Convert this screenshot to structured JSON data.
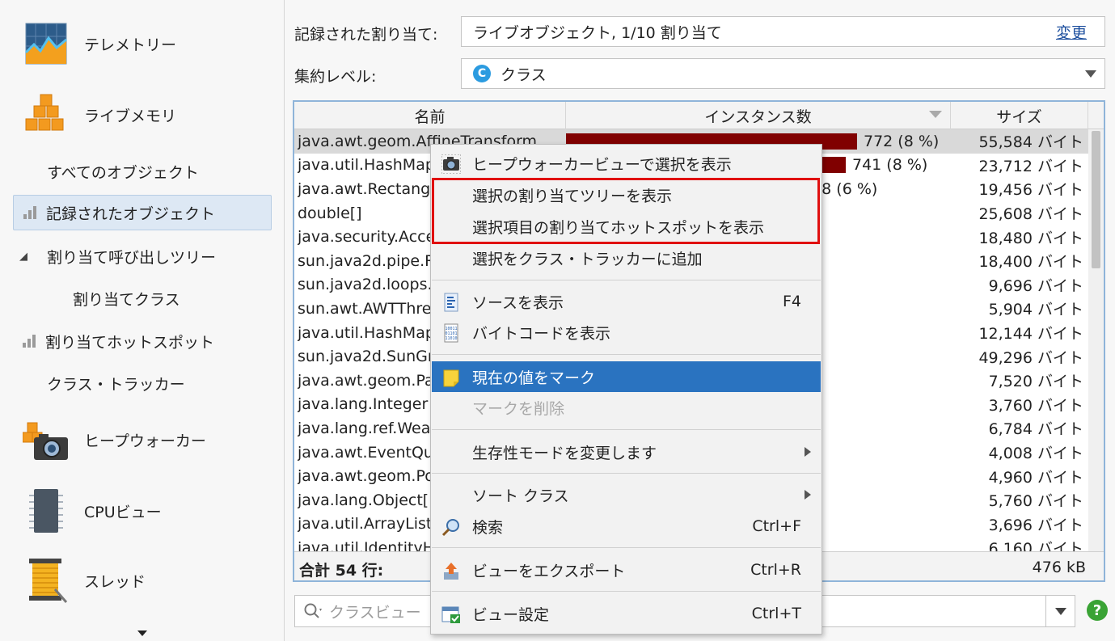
{
  "sidebar": {
    "items": [
      {
        "label": "テレメトリー",
        "icon": "telemetry-icon"
      },
      {
        "label": "ライブメモリ",
        "icon": "live-memory-icon"
      },
      {
        "label": "すべてのオブジェクト"
      },
      {
        "label": "記録されたオブジェクト",
        "selected": true
      },
      {
        "label": "割り当て呼び出しツリー"
      },
      {
        "label": "割り当てクラス"
      },
      {
        "label": "割り当てホットスポット"
      },
      {
        "label": "クラス・トラッカー"
      },
      {
        "label": "ヒープウォーカー",
        "icon": "heap-walker-icon"
      },
      {
        "label": "CPUビュー",
        "icon": "cpu-view-icon"
      },
      {
        "label": "スレッド",
        "icon": "threads-icon"
      }
    ]
  },
  "header": {
    "recorded_label": "記録された割り当て:",
    "recorded_value": "ライブオブジェクト, 1/10 割り当て",
    "change_link": "変更",
    "aggregation_label": "集約レベル:",
    "aggregation_icon_letter": "C",
    "aggregation_value": "クラス"
  },
  "table": {
    "columns": {
      "name": "名前",
      "instances": "インスタンス数",
      "size": "サイズ"
    },
    "rows": [
      {
        "name": "java.awt.geom.AffineTransform",
        "instances": "772 (8 %)",
        "size": "55,584 バイト",
        "bar": 1.0
      },
      {
        "name": "java.util.HashMap",
        "instances": "741 (8 %)",
        "size": "23,712 バイト",
        "bar": 0.96
      },
      {
        "name": "java.awt.Rectangle",
        "instances": "608 (6 %)",
        "size": "19,456 バイト",
        "bar": 0.79
      },
      {
        "name": "double[]",
        "instances": "",
        "size": "25,608 バイト",
        "bar": 0
      },
      {
        "name": "java.security.AccessControlContext",
        "instances": "",
        "size": "18,480 バイト",
        "bar": 0
      },
      {
        "name": "sun.java2d.pipe.Region",
        "instances": "",
        "size": "18,400 バイト",
        "bar": 0
      },
      {
        "name": "sun.java2d.loops.FontInfo",
        "instances": "",
        "size": "9,696 バイト",
        "bar": 0
      },
      {
        "name": "sun.awt.AWTThreading",
        "instances": "",
        "size": "5,904 バイト",
        "bar": 0
      },
      {
        "name": "java.util.HashMap$Node",
        "instances": "",
        "size": "12,144 バイト",
        "bar": 0
      },
      {
        "name": "sun.java2d.SunGraphics2D",
        "instances": "",
        "size": "49,296 バイト",
        "bar": 0
      },
      {
        "name": "java.awt.geom.Path2D",
        "instances": "",
        "size": "7,520 バイト",
        "bar": 0
      },
      {
        "name": "java.lang.Integer",
        "instances": "",
        "size": "3,760 バイト",
        "bar": 0
      },
      {
        "name": "java.lang.ref.WeakReference",
        "instances": "",
        "size": "6,784 バイト",
        "bar": 0
      },
      {
        "name": "java.awt.EventQueueItem",
        "instances": "",
        "size": "4,008 バイト",
        "bar": 0
      },
      {
        "name": "java.awt.geom.Point2D",
        "instances": "",
        "size": "4,960 バイト",
        "bar": 0
      },
      {
        "name": "java.lang.Object[]",
        "instances": "",
        "size": "5,760 バイト",
        "bar": 0
      },
      {
        "name": "java.util.ArrayList",
        "instances": "",
        "size": "3,696 バイト",
        "bar": 0
      },
      {
        "name": "java.util.IdentityHashMap",
        "instances": "",
        "size": "6,160 バイト",
        "bar": 0
      }
    ],
    "footer": {
      "total": "合計 54 行:",
      "sum": "476 kB"
    }
  },
  "search": {
    "placeholder": "クラスビュー"
  },
  "help_label": "?",
  "context_menu": {
    "items": [
      {
        "label": "ヒープウォーカービューで選択を表示",
        "icon": "camera-icon",
        "shortcut": ""
      },
      {
        "label": "選択の割り当てツリーを表示",
        "shortcut": ""
      },
      {
        "label": "選択項目の割り当てホットスポットを表示",
        "shortcut": ""
      },
      {
        "label": "選択をクラス・トラッカーに追加",
        "shortcut": ""
      },
      {
        "label": "ソースを表示",
        "icon": "source-icon",
        "shortcut": "F4"
      },
      {
        "label": "バイトコードを表示",
        "icon": "bytecode-icon",
        "shortcut": ""
      },
      {
        "label": "現在の値をマーク",
        "icon": "note-icon",
        "shortcut": "",
        "highlighted": true
      },
      {
        "label": "マークを削除",
        "shortcut": "",
        "disabled": true
      },
      {
        "label": "生存性モードを変更します",
        "shortcut": "",
        "submenu": true
      },
      {
        "label": "ソート クラス",
        "shortcut": "",
        "submenu": true
      },
      {
        "label": "検索",
        "icon": "magnifier-icon",
        "shortcut": "Ctrl+F"
      },
      {
        "label": "ビューをエクスポート",
        "icon": "export-icon",
        "shortcut": "Ctrl+R"
      },
      {
        "label": "ビュー設定",
        "icon": "view-settings-icon",
        "shortcut": "Ctrl+T"
      }
    ]
  },
  "colors": {
    "accent": "#2a73c0",
    "bar": "#800000",
    "highlight_box": "#e01010"
  }
}
